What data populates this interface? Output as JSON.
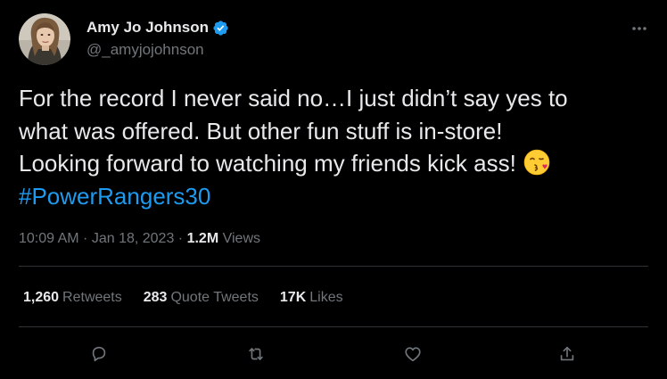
{
  "author": {
    "display_name": "Amy Jo Johnson",
    "handle": "@_amyjojohnson",
    "verified": true
  },
  "tweet": {
    "lines": [
      "For the record I never said no…I just didn’t say yes to",
      "what was offered. But other fun stuff is in-store!",
      "Looking forward to watching my friends kick ass!"
    ],
    "emoji": "face-blowing-a-kiss",
    "hashtag": "#PowerRangers30"
  },
  "meta": {
    "time": "10:09 AM",
    "sep1": " · ",
    "date": "Jan 18, 2023",
    "sep2": " · ",
    "views_count": "1.2M",
    "views_label": " Views"
  },
  "stats": {
    "retweets_count": "1,260",
    "retweets_label": "Retweets",
    "quotes_count": "283",
    "quotes_label": "Quote Tweets",
    "likes_count": "17K",
    "likes_label": "Likes"
  },
  "actions": [
    "reply-icon",
    "retweet-icon",
    "like-icon",
    "share-icon"
  ],
  "colors": {
    "background": "#000000",
    "text": "#e7e9ea",
    "muted": "#71767b",
    "accent": "#1d9bf0",
    "divider": "#2f3336"
  }
}
